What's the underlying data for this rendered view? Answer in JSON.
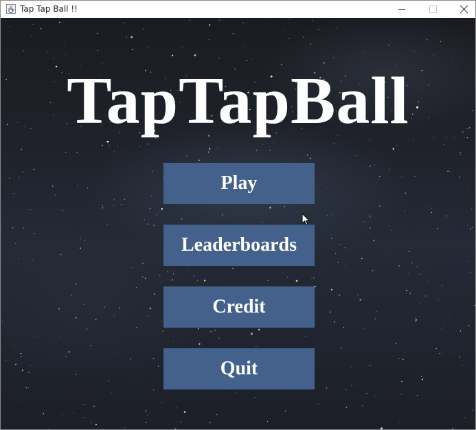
{
  "window": {
    "title": "Tap Tap Ball !!",
    "icon": "java-cup-icon",
    "controls": [
      "minimize",
      "maximize",
      "close"
    ]
  },
  "game": {
    "title": "TapTapBall",
    "background": "starfield-night-sky",
    "colors": {
      "title_text": "#ffffff",
      "button_bg": "#43618b",
      "button_text": "#ffffff"
    },
    "menu": {
      "play_label": "Play",
      "leaderboards_label": "Leaderboards",
      "credit_label": "Credit",
      "quit_label": "Quit"
    }
  }
}
